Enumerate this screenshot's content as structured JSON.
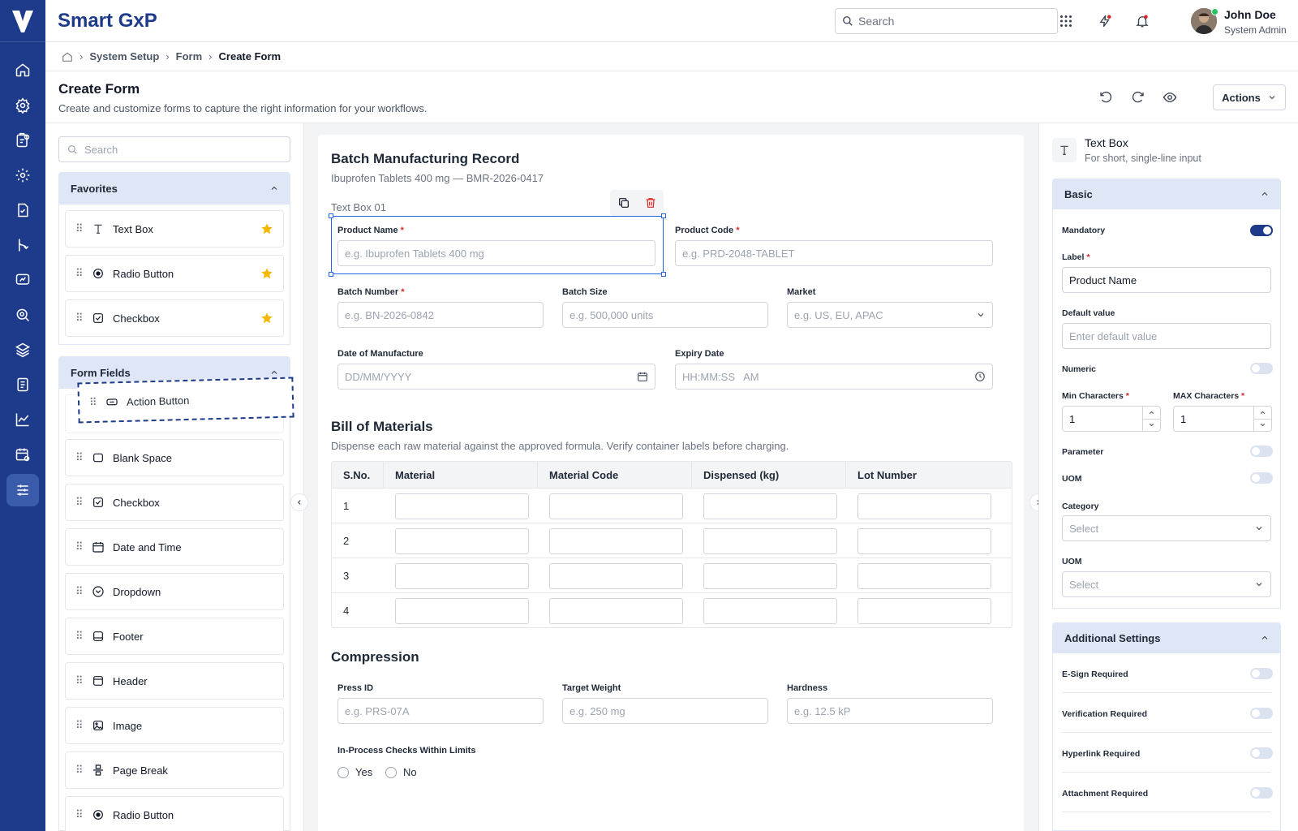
{
  "app": {
    "title": "Smart GxP"
  },
  "header": {
    "search_placeholder": "Search",
    "user_name": "John Doe",
    "user_role": "System Admin"
  },
  "breadcrumb": [
    "System Setup",
    "Form",
    "Create Form"
  ],
  "page": {
    "title": "Create Form",
    "subtitle": "Create and customize forms to capture the right information for your workflows.",
    "actions_label": "Actions"
  },
  "sidebar": {
    "items": [
      "home-icon",
      "settings-icon",
      "clipboard-icon",
      "gear-icon",
      "document-check-icon",
      "branch-icon",
      "chat-icon",
      "search-gear-icon",
      "layers-icon",
      "report-icon",
      "chart-icon",
      "calendar-settings-icon",
      "sliders-icon"
    ],
    "active": 12
  },
  "left": {
    "search_placeholder": "Search",
    "favorites": {
      "title": "Favorites",
      "items": [
        "Text Box",
        "Radio Button",
        "Checkbox"
      ]
    },
    "form_fields": {
      "title": "Form Fields",
      "items": [
        "Blank Space",
        "Checkbox",
        "Date and Time",
        "Dropdown",
        "Footer",
        "Header",
        "Image",
        "Page Break",
        "Radio Button"
      ]
    },
    "dragging": "Action Button"
  },
  "form": {
    "title": "Batch Manufacturing Record",
    "subtitle": "Ibuprofen Tablets 400 mg — BMR-2026-0417",
    "selected_caption": "Text Box 01",
    "product_name": {
      "label": "Product Name",
      "placeholder": "e.g. Ibuprofen Tablets 400 mg"
    },
    "product_code": {
      "label": "Product Code",
      "placeholder": "e.g. PRD-2048-TABLET"
    },
    "batch_number": {
      "label": "Batch Number",
      "placeholder": "e.g. BN-2026-0842"
    },
    "batch_size": {
      "label": "Batch Size",
      "placeholder": "e.g. 500,000 units"
    },
    "market": {
      "label": "Market",
      "placeholder": "e.g. US, EU, APAC"
    },
    "date_of_manufacture": {
      "label": "Date of Manufacture",
      "placeholder": "DD/MM/YYYY"
    },
    "expiry_date": {
      "label": "Expiry Date",
      "placeholder": "HH:MM:SS   AM"
    },
    "bom": {
      "title": "Bill of Materials",
      "subtitle": "Dispense each raw material against the approved formula. Verify container labels before charging.",
      "columns": [
        "S.No.",
        "Material",
        "Material Code",
        "Dispensed (kg)",
        "Lot Number"
      ],
      "rows": [
        "1",
        "2",
        "3",
        "4"
      ]
    },
    "compression": {
      "title": "Compression",
      "press_id": {
        "label": "Press ID",
        "placeholder": "e.g. PRS-07A"
      },
      "target_weight": {
        "label": "Target Weight",
        "placeholder": "e.g. 250 mg"
      },
      "hardness": {
        "label": "Hardness",
        "placeholder": "e.g. 12.5 kP"
      },
      "checks": {
        "label": "In-Process Checks Within Limits",
        "options": [
          "Yes",
          "No"
        ]
      }
    }
  },
  "props": {
    "type_title": "Text Box",
    "type_desc": "For short, single-line input",
    "basic": {
      "title": "Basic",
      "mandatory": "Mandatory",
      "label": "Label",
      "label_value": "Product Name",
      "default_value": "Default value",
      "default_placeholder": "Enter default value",
      "numeric": "Numeric",
      "min_chars": "Min Characters",
      "min_value": "1",
      "max_chars": "MAX Characters",
      "max_value": "1",
      "parameter": "Parameter",
      "uom": "UOM",
      "category": "Category",
      "category_value": "Select",
      "uom2": "UOM",
      "uom_value": "Select",
      "toggles": {
        "mandatory": true,
        "numeric": false,
        "parameter": false,
        "uom": false
      }
    },
    "additional": {
      "title": "Additional Settings",
      "items": [
        "E-Sign Required",
        "Verification Required",
        "Hyperlink Required",
        "Attachment Required"
      ]
    }
  },
  "colors": {
    "brand": "#1e3a8a",
    "accent": "#2563eb",
    "star": "#f5b800",
    "danger": "#dc2626",
    "online": "#22c55e"
  }
}
